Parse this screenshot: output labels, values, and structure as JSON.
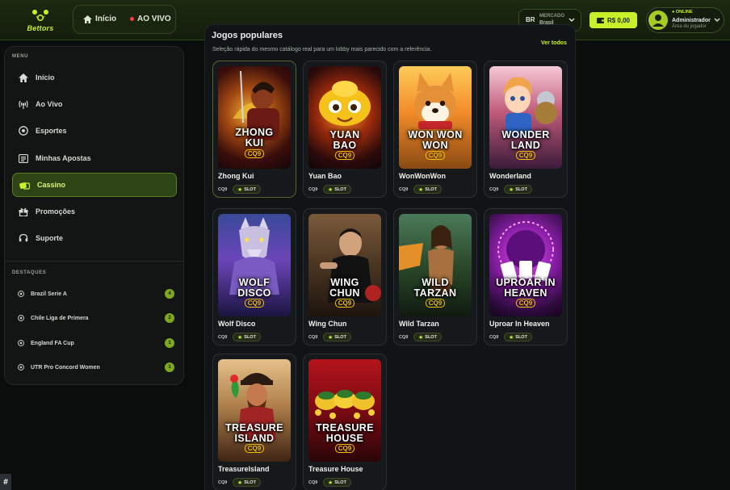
{
  "header": {
    "logo_text": "Bettors",
    "nav_home": "Início",
    "nav_live": "AO VIVO",
    "market_code": "BR",
    "market_label": "MERCADO",
    "market_value": "Brasil",
    "balance": "R$ 0,00",
    "user_status": "ONLINE",
    "user_name": "Administrador",
    "user_role": "Área do jogador"
  },
  "sidebar": {
    "menu_title": "MENU",
    "items": [
      {
        "label": "Início",
        "icon": "home-icon"
      },
      {
        "label": "Ao Vivo",
        "icon": "broadcast-icon"
      },
      {
        "label": "Esportes",
        "icon": "soccer-ball-icon"
      },
      {
        "label": "Minhas Apostas",
        "icon": "ticket-list-icon"
      },
      {
        "label": "Cassino",
        "icon": "chips-icon",
        "active": true
      },
      {
        "label": "Promoções",
        "icon": "gift-icon"
      },
      {
        "label": "Suporte",
        "icon": "headset-icon"
      }
    ],
    "highlights_title": "DESTAQUES",
    "highlights": [
      {
        "label": "Brazil Serie A",
        "count": "4"
      },
      {
        "label": "Chile Liga de Primera",
        "count": "2"
      },
      {
        "label": "England FA Cup",
        "count": "1"
      },
      {
        "label": "UTR Pro Concord Women",
        "count": "1"
      }
    ]
  },
  "main": {
    "heading": "Jogos populares",
    "description": "Seleção rápida do mesmo catálogo real para um lobby mais parecido com a referência.",
    "see_all": "Ver todos",
    "games": [
      {
        "name": "Zhong Kui",
        "art_line1": "ZHONG",
        "art_line2": "KUI",
        "provider": "CQ9",
        "tag": "SLOT"
      },
      {
        "name": "Yuan Bao",
        "art_line1": "YUAN",
        "art_line2": "BAO",
        "provider": "CQ9",
        "tag": "SLOT"
      },
      {
        "name": "WonWonWon",
        "art_line1": "WON WON",
        "art_line2": "WON",
        "provider": "CQ9",
        "tag": "SLOT"
      },
      {
        "name": "Wonderland",
        "art_line1": "WONDER",
        "art_line2": "LAND",
        "provider": "CQ9",
        "tag": "SLOT"
      },
      {
        "name": "Wolf Disco",
        "art_line1": "WOLF",
        "art_line2": "DISCO",
        "provider": "CQ9",
        "tag": "SLOT"
      },
      {
        "name": "Wing Chun",
        "art_line1": "WING",
        "art_line2": "CHUN",
        "provider": "CQ9",
        "tag": "SLOT"
      },
      {
        "name": "Wild Tarzan",
        "art_line1": "WILD",
        "art_line2": "TARZAN",
        "provider": "CQ9",
        "tag": "SLOT"
      },
      {
        "name": "Uproar In Heaven",
        "art_line1": "UPROAR IN",
        "art_line2": "HEAVEN",
        "provider": "CQ9",
        "tag": "SLOT"
      },
      {
        "name": "TreasureIsland",
        "art_line1": "TREASURE",
        "art_line2": "ISLAND",
        "provider": "CQ9",
        "tag": "SLOT"
      },
      {
        "name": "Treasure House",
        "art_line1": "TREASURE",
        "art_line2": "HOUSE",
        "provider": "CQ9",
        "tag": "SLOT"
      }
    ]
  },
  "debug_badge": "#",
  "colors": {
    "accent": "#c8f02a",
    "brand_dark": "#1c2a11",
    "live": "#ff3b3b"
  }
}
